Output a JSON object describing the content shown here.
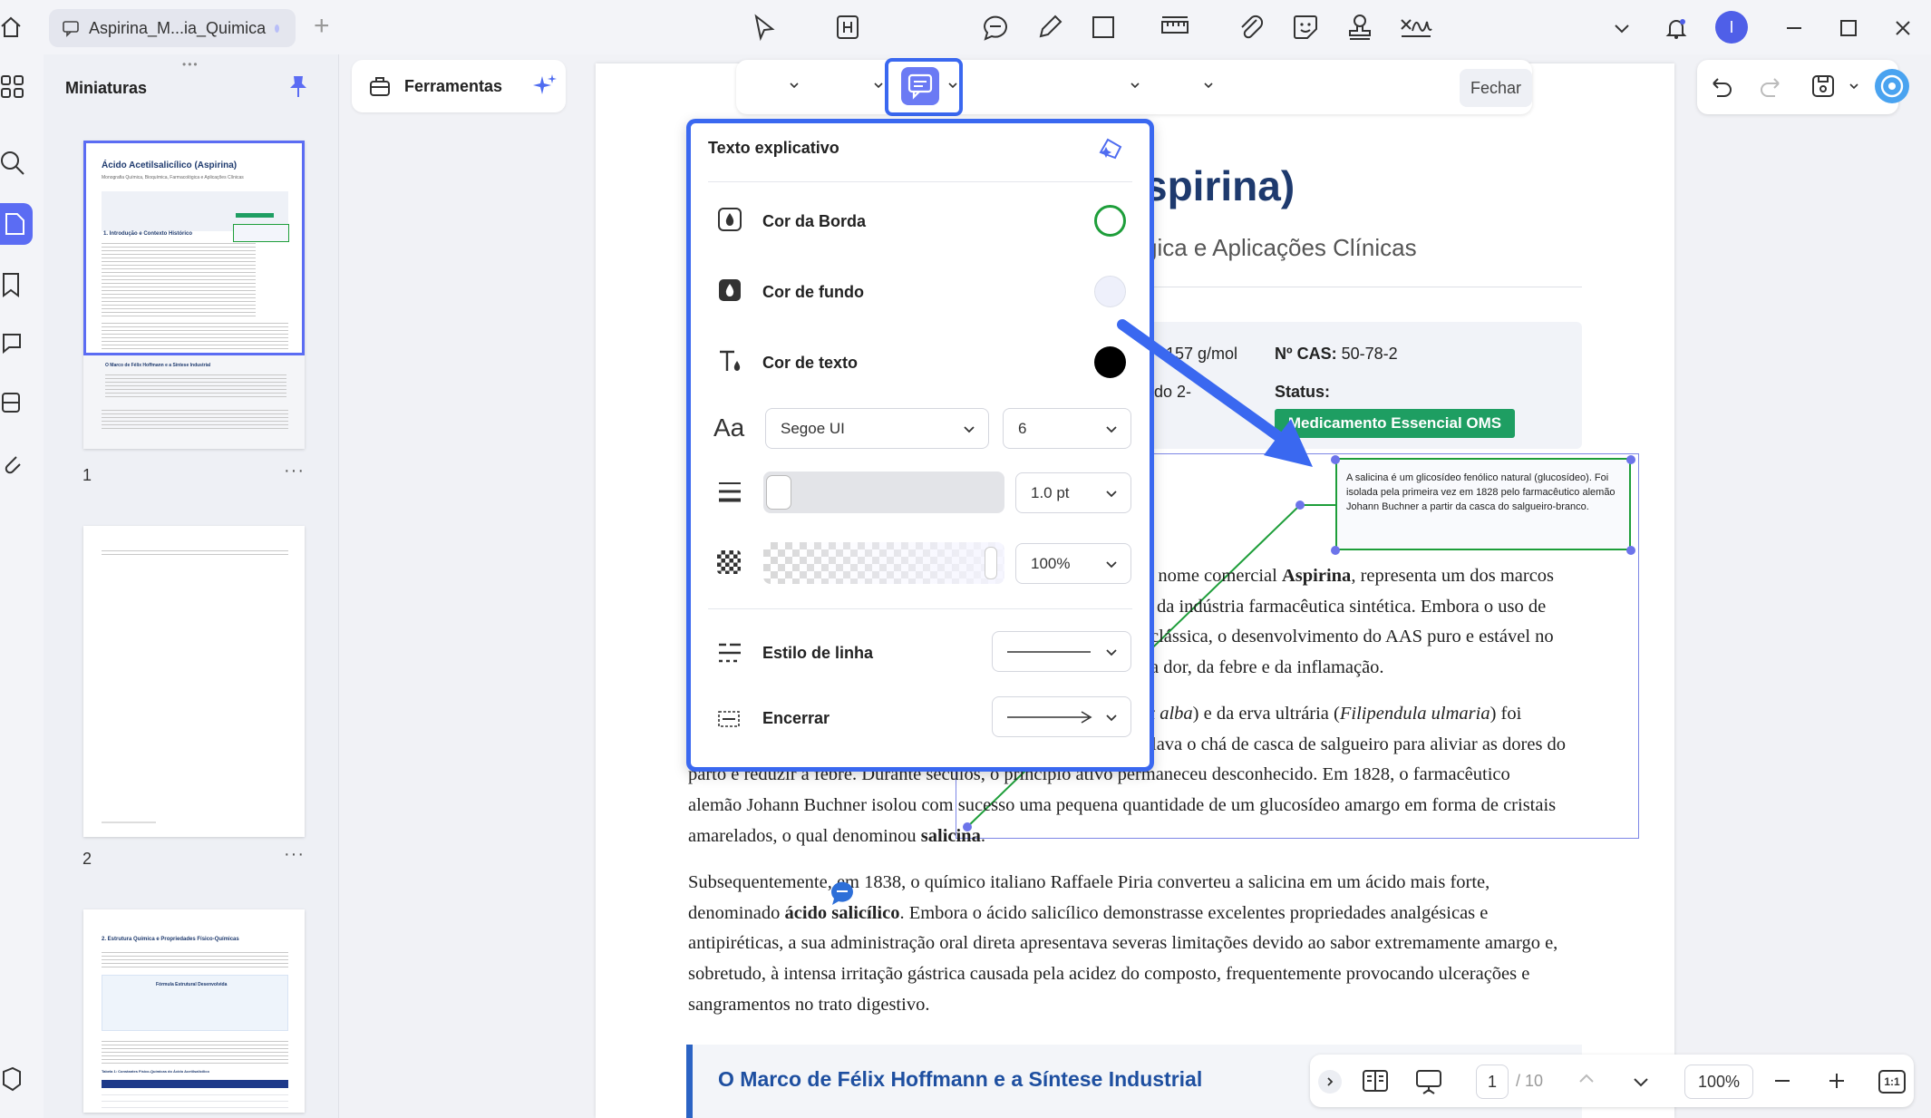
{
  "tab": {
    "title": "Aspirina_M...ia_Quimica"
  },
  "sidebar": {
    "title": "Miniaturas",
    "pages": [
      {
        "num": "1"
      },
      {
        "num": "2"
      }
    ]
  },
  "tools": {
    "label": "Ferramentas"
  },
  "toolbar": {
    "close_label": "Fechar"
  },
  "popup": {
    "title": "Texto explicativo",
    "border_color_label": "Cor da Borda",
    "fill_color_label": "Cor de fundo",
    "text_color_label": "Cor de texto",
    "font_family": "Segoe UI",
    "font_size": "6",
    "line_width": "1.0 pt",
    "opacity": "100%",
    "opacity_value": 1.0,
    "line_style_label": "Estilo de linha",
    "end_label": "Encerrar",
    "colors": {
      "border": "#1e9e3a",
      "fill": "#eef0fb",
      "text": "#000000"
    }
  },
  "document": {
    "title_fragment": "spirina)",
    "subtitle_fragment": "gica e Aplicações Clínicas",
    "info": {
      "mass_fragment": "157 g/mol",
      "cas_label": "Nº CAS:",
      "cas_value": "50-78-2",
      "name_fragment": "do 2-",
      "status_label": "Status:",
      "status_badge": "Medicamento Essencial OMS"
    },
    "callout_text": "A salicina é um glicosídeo fenólico natural (glucosídeo). Foi isolada pela primeira vez em 1828 pelo farmacêutico alemão Johann Buchner a partir da casca do salgueiro-branco.",
    "para1": {
      "l1a": "o nome comercial ",
      "l1b": "Aspirina",
      "l1c": ", representa um dos marcos",
      "l2": "da indústria farmacêutica sintética. Embora o uso de",
      "l3": "clássica, o desenvolvimento do AAS puro e estável no",
      "l4": "a dor, da febre e da inflamação."
    },
    "para2": {
      "l1a": "x alba",
      "l1b": ") e da erva ultrária (",
      "l1c": "Filipendula ulmaria",
      "l1d": ") foi",
      "l2": "lava o chá de casca de salgueiro para aliviar as dores do",
      "l3": "parto e reduzir a febre. Durante séculos, o princípio ativo permaneceu desconhecido. Em 1828, o farmacêutico",
      "l4": "alemão Johann Buchner isolou com sucesso uma pequena quantidade de um glucosídeo amargo em forma de cristais",
      "l5a": "amarelados, o qual denominou ",
      "l5b": "salicina",
      "l5c": "."
    },
    "para3": {
      "l1": "Subsequentemente, em 1838, o químico italiano Raffaele Piria converteu a salicina em um ácido mais forte,",
      "l2a": "denominado ",
      "l2b": "ácido salicílico",
      "l2c": ". Embora o ácido salicílico demonstrasse excelentes propriedades analgésicas e",
      "l3": "antipiréticas, a sua administração oral direta apresentava severas limitações devido ao sabor extremamente amargo e,",
      "l4": "sobretudo, à intensa irritação gástrica causada pela acidez do composto, frequentemente provocando ulcerações e",
      "l5": "sangramentos no trato digestivo."
    },
    "section_heading": "O Marco de Félix Hoffmann e a Síntese Industrial"
  },
  "thumb1": {
    "title": "Ácido Acetilsalicílico (Aspirina)",
    "subtitle": "Monografia Química, Bioquímica, Farmacológica e Aplicações Clínicas",
    "section": "1. Introdução e Contexto Histórico",
    "subsection": "O Marco de Félix Hoffmann e a Síntese Industrial"
  },
  "thumb3": {
    "section": "2. Estrutura Química e Propriedades Físico-Químicas",
    "box_title": "Fórmula Estrutural Desenvolvida",
    "table_title": "Tabela 1: Constantes Físico-Químicas do Ácido Acetilsalicílico"
  },
  "navigation": {
    "current_page": "1",
    "total_pages": "/ 10",
    "zoom": "100%",
    "fit_label": "1:1"
  }
}
